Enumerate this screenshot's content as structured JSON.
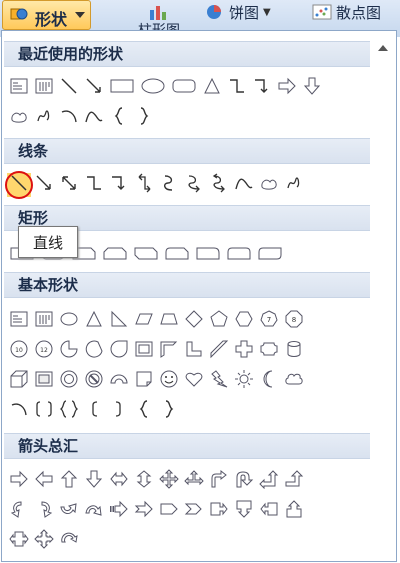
{
  "ribbon": {
    "shape_button_label": "形状",
    "chart_bar_label": "柱形图",
    "chart_pie_label": "饼图",
    "chart_scatter_label": "散点图"
  },
  "sections": {
    "recent": "最近使用的形状",
    "lines": "线条",
    "rectangles": "矩形",
    "basic": "基本形状",
    "arrows": "箭头总汇"
  },
  "tooltip": "直线",
  "colors": {
    "accent_orange": "#ffc95a",
    "selection_red": "#dd1111",
    "section_bg": "#dfe6f1"
  }
}
